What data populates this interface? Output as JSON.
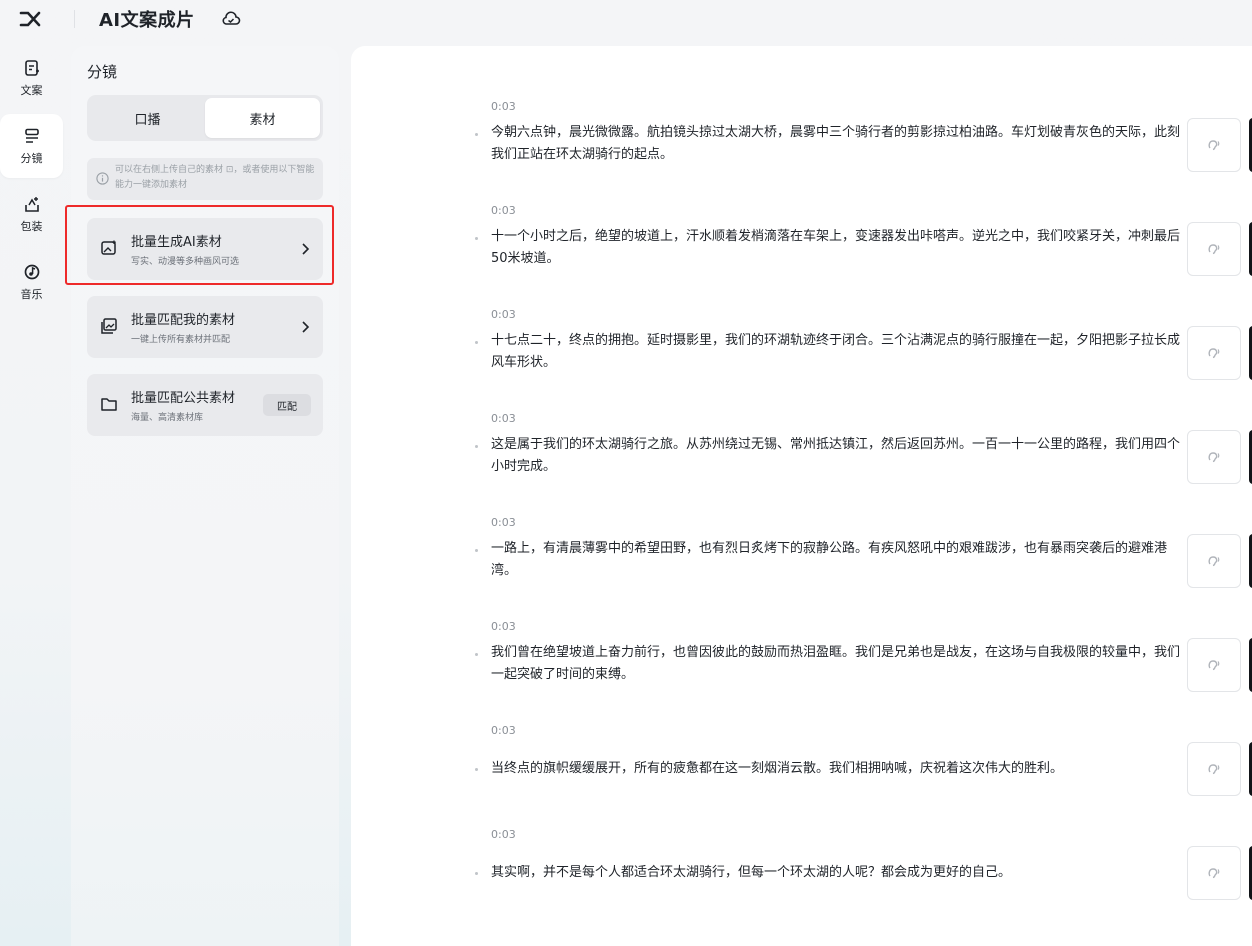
{
  "app": {
    "title": "AI文案成片"
  },
  "icons": {
    "logo": "capcut-logo-icon",
    "cloud": "cloud-sync-icon"
  },
  "rail": [
    {
      "label": "文案",
      "icon": "script-icon",
      "active": false
    },
    {
      "label": "分镜",
      "icon": "storyboard-icon",
      "active": true
    },
    {
      "label": "包装",
      "icon": "packaging-icon",
      "active": false
    },
    {
      "label": "音乐",
      "icon": "music-icon",
      "active": false
    }
  ],
  "panel": {
    "title": "分镜",
    "tabs": [
      {
        "label": "口播",
        "active": false
      },
      {
        "label": "素材",
        "active": true
      }
    ],
    "tip": "可以在右侧上传自己的素材 ⊡，或者使用以下智能能力一键添加素材",
    "cards": [
      {
        "title": "批量生成AI素材",
        "subtitle": "写实、动漫等多种画风可选",
        "icon": "ai-image-icon",
        "action": "chevron"
      },
      {
        "title": "批量匹配我的素材",
        "subtitle": "一键上传所有素材并匹配",
        "icon": "gallery-icon",
        "action": "chevron"
      },
      {
        "title": "批量匹配公共素材",
        "subtitle": "海量、高清素材库",
        "icon": "folder-icon",
        "action": "badge",
        "badge": "匹配"
      }
    ]
  },
  "segments": [
    {
      "time": "0:03",
      "text": "今朝六点钟，晨光微微露。航拍镜头掠过太湖大桥，晨雾中三个骑行者的剪影掠过柏油路。车灯划破青灰色的天际，此刻我们正站在环太湖骑行的起点。"
    },
    {
      "time": "0:03",
      "text": "十一个小时之后，绝望的坡道上，汗水顺着发梢滴落在车架上，变速器发出咔嗒声。逆光之中，我们咬紧牙关，冲刺最后50米坡道。"
    },
    {
      "time": "0:03",
      "text": "十七点二十，终点的拥抱。延时摄影里，我们的环湖轨迹终于闭合。三个沾满泥点的骑行服撞在一起，夕阳把影子拉长成风车形状。"
    },
    {
      "time": "0:03",
      "text": "这是属于我们的环太湖骑行之旅。从苏州绕过无锡、常州抵达镇江，然后返回苏州。一百一十一公里的路程，我们用四个小时完成。"
    },
    {
      "time": "0:03",
      "text": "一路上，有清晨薄雾中的希望田野，也有烈日炙烤下的寂静公路。有疾风怒吼中的艰难跋涉，也有暴雨突袭后的避难港湾。"
    },
    {
      "time": "0:03",
      "text": "我们曾在绝望坡道上奋力前行，也曾因彼此的鼓励而热泪盈眶。我们是兄弟也是战友，在这场与自我极限的较量中，我们一起突破了时间的束缚。"
    },
    {
      "time": "0:03",
      "text": "当终点的旗帜缓缓展开，所有的疲惫都在这一刻烟消云散。我们相拥呐喊，庆祝着这次伟大的胜利。"
    },
    {
      "time": "0:03",
      "text": "其实啊，并不是每个人都适合环太湖骑行，但每一个环太湖的人呢？都会成为更好的自己。"
    }
  ],
  "colors": {
    "highlight": "#ee2a2a",
    "accent": "#1f2329"
  }
}
